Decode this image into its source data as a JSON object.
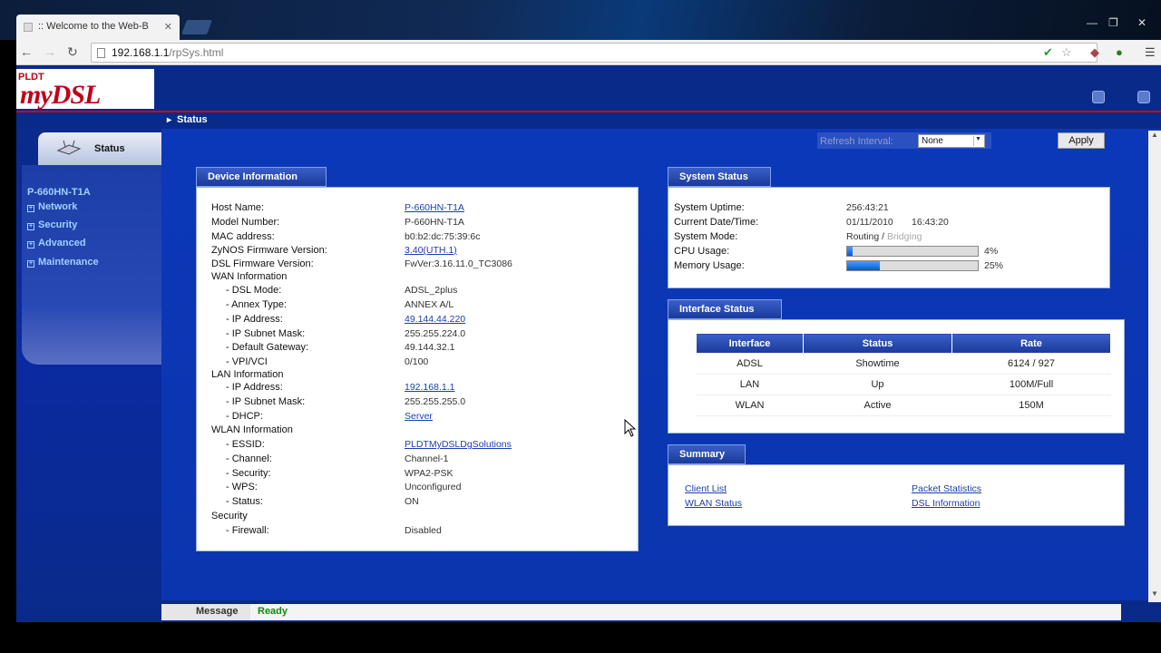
{
  "browser": {
    "tab_title": ":: Welcome to the Web-B",
    "url_host": "192.168.1.1",
    "url_path": "/rpSys.html"
  },
  "header": {
    "logo_top": "PLDT",
    "logo_main": "myDSL",
    "breadcrumb": "Status"
  },
  "sidebar": {
    "tab_label": "Status",
    "model": "P-660HN-T1A",
    "items": [
      {
        "label": "Network"
      },
      {
        "label": "Security"
      },
      {
        "label": "Advanced"
      },
      {
        "label": "Maintenance"
      }
    ]
  },
  "refresh": {
    "label": "Refresh Interval:",
    "selected": "None",
    "apply_label": "Apply"
  },
  "device_info": {
    "title": "Device Information",
    "rows": [
      {
        "label": "Host Name:",
        "value": "P-660HN-T1A",
        "link": true
      },
      {
        "label": "Model Number:",
        "value": "P-660HN-T1A"
      },
      {
        "label": "MAC address:",
        "value": "b0:b2:dc:75:39:6c"
      },
      {
        "label": "ZyNOS Firmware Version:",
        "value": "3.40(UTH.1)",
        "link": true
      },
      {
        "label": "DSL Firmware Version:",
        "value": "FwVer:3.16.11.0_TC3086"
      },
      {
        "label": "WAN Information",
        "value": ""
      },
      {
        "label": "- DSL Mode:",
        "value": "ADSL_2plus"
      },
      {
        "label": "- Annex Type:",
        "value": "ANNEX A/L"
      },
      {
        "label": "- IP Address:",
        "value": "49.144.44.220",
        "link": true
      },
      {
        "label": "- IP Subnet Mask:",
        "value": "255.255.224.0"
      },
      {
        "label": "- Default Gateway:",
        "value": "49.144.32.1"
      },
      {
        "label": "- VPI/VCI",
        "value": "0/100"
      },
      {
        "label": "LAN Information",
        "value": ""
      },
      {
        "label": "- IP Address:",
        "value": "192.168.1.1",
        "link": true
      },
      {
        "label": "- IP Subnet Mask:",
        "value": "255.255.255.0"
      },
      {
        "label": "- DHCP:",
        "value": "Server",
        "link": true
      },
      {
        "label": "WLAN Information",
        "value": ""
      },
      {
        "label": "- ESSID:",
        "value": "PLDTMyDSLDgSolutions",
        "link": true
      },
      {
        "label": "- Channel:",
        "value": "Channel-1"
      },
      {
        "label": "- Security:",
        "value": "WPA2-PSK"
      },
      {
        "label": "- WPS:",
        "value": "Unconfigured"
      },
      {
        "label": "- Status:",
        "value": "ON"
      },
      {
        "label": "Security",
        "value": ""
      },
      {
        "label": "- Firewall:",
        "value": "Disabled"
      }
    ]
  },
  "system_status": {
    "title": "System Status",
    "uptime_label": "System Uptime:",
    "uptime": "256:43:21",
    "datetime_label": "Current Date/Time:",
    "date": "01/11/2010",
    "time": "16:43:20",
    "mode_label": "System Mode:",
    "mode_active": "Routing",
    "mode_sep": " / ",
    "mode_inactive": "Bridging",
    "cpu_label": "CPU Usage:",
    "cpu_pct": 4,
    "cpu_text": "4%",
    "mem_label": "Memory Usage:",
    "mem_pct": 25,
    "mem_text": "25%"
  },
  "interface_status": {
    "title": "Interface Status",
    "headers": [
      "Interface",
      "Status",
      "Rate"
    ],
    "rows": [
      [
        "ADSL",
        "Showtime",
        "6124 / 927"
      ],
      [
        "LAN",
        "Up",
        "100M/Full"
      ],
      [
        "WLAN",
        "Active",
        "150M"
      ]
    ]
  },
  "summary": {
    "title": "Summary",
    "links": [
      "Client List",
      "WLAN Status",
      "Packet Statistics",
      "DSL Information"
    ]
  },
  "statusbar": {
    "label": "Message",
    "value": "Ready"
  }
}
